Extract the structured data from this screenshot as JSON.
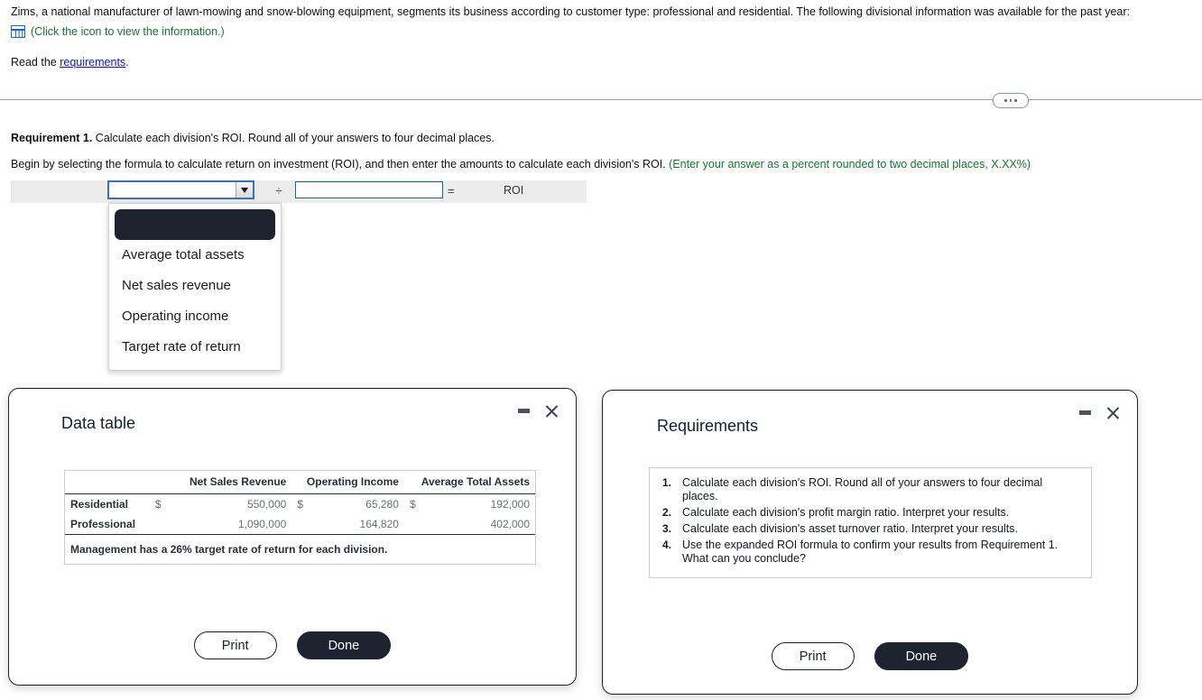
{
  "intro": {
    "paragraph": "Zims, a national manufacturer of lawn-mowing and snow-blowing equipment, segments its business according to customer type: professional and residential. The following divisional information was available for the past year:",
    "icon_note": "(Click the icon to view the information.)",
    "icon_name": "table-grid-icon",
    "read_prefix": "Read the",
    "read_link": "requirements",
    "read_suffix": "."
  },
  "requirement": {
    "label": "Requirement 1.",
    "text": "Calculate each division's ROI. Round all of your answers to four decimal places.",
    "begin_text": "Begin by selecting the formula to calculate return on investment (ROI), and then enter the amounts to calculate each division's ROI.",
    "begin_hint": "(Enter your answer as a percent rounded to two decimal places, X.XX%)"
  },
  "formula": {
    "numerator_value": "",
    "numerator_placeholder": "",
    "divide_symbol": "÷",
    "denominator_value": "",
    "denominator_placeholder": "",
    "equals_symbol": "=",
    "result_label": "ROI"
  },
  "dropdown": {
    "open": true,
    "options": [
      "",
      "Average total assets",
      "Net sales revenue",
      "Operating income",
      "Target rate of return"
    ],
    "highlighted_index": 0
  },
  "data_table_dialog": {
    "title": "Data table",
    "minimize_icon": "minimize-icon",
    "close_icon": "close-icon",
    "columns": [
      "",
      "Net Sales Revenue",
      "Operating Income",
      "Average Total Assets"
    ],
    "rows": [
      {
        "label": "Residential",
        "net_sales_currency": "$",
        "net_sales_revenue": "550,000",
        "operating_currency": "$",
        "operating_income": "65,280",
        "assets_currency": "$",
        "average_total_assets": "192,000"
      },
      {
        "label": "Professional",
        "net_sales_currency": "",
        "net_sales_revenue": "1,090,000",
        "operating_currency": "",
        "operating_income": "164,820",
        "assets_currency": "",
        "average_total_assets": "402,000"
      }
    ],
    "note": "Management has a 26% target rate of return for each division.",
    "print_label": "Print",
    "done_label": "Done"
  },
  "requirements_dialog": {
    "title": "Requirements",
    "minimize_icon": "minimize-icon",
    "close_icon": "close-icon",
    "items": [
      {
        "num": "1.",
        "text": "Calculate each division's ROI. Round all of your answers to four decimal places."
      },
      {
        "num": "2.",
        "text": "Calculate each division's profit margin ratio. Interpret your results."
      },
      {
        "num": "3.",
        "text": "Calculate each division's asset turnover ratio. Interpret your results."
      },
      {
        "num": "4.",
        "text": "Use the expanded ROI formula to confirm your results from Requirement 1. What can you conclude?"
      }
    ],
    "print_label": "Print",
    "done_label": "Done"
  },
  "colors": {
    "link": "#1414d2",
    "hint_green": "#127a2f",
    "dialog_border": "#1b1f26",
    "done_button": "#1d2430",
    "focus_border": "#3b6fc4",
    "input_border": "#166a86"
  }
}
